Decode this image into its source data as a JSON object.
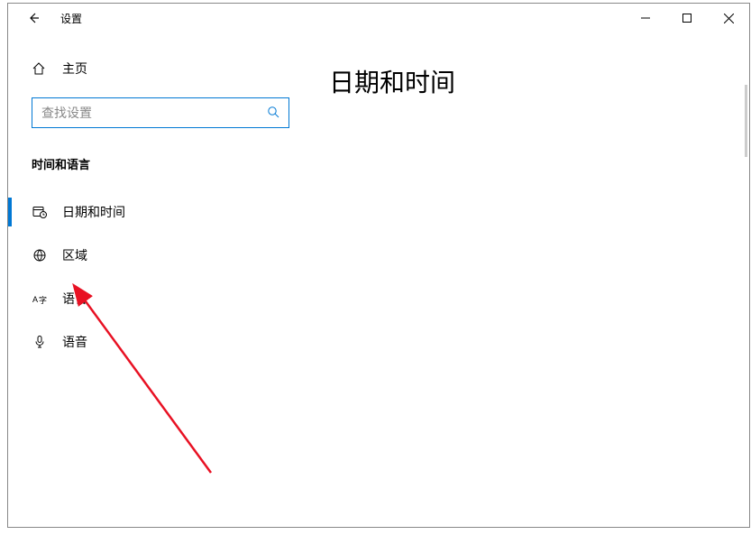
{
  "window": {
    "title": "设置"
  },
  "sidebar": {
    "home": "主页",
    "search_placeholder": "查找设置",
    "category": "时间和语言",
    "items": [
      {
        "label": "日期和时间",
        "icon": "calendar-clock-icon",
        "selected": true
      },
      {
        "label": "区域",
        "icon": "globe-icon",
        "selected": false
      },
      {
        "label": "语言",
        "icon": "language-icon",
        "selected": false
      },
      {
        "label": "语音",
        "icon": "microphone-icon",
        "selected": false
      }
    ]
  },
  "main": {
    "page_title": "日期和时间"
  }
}
